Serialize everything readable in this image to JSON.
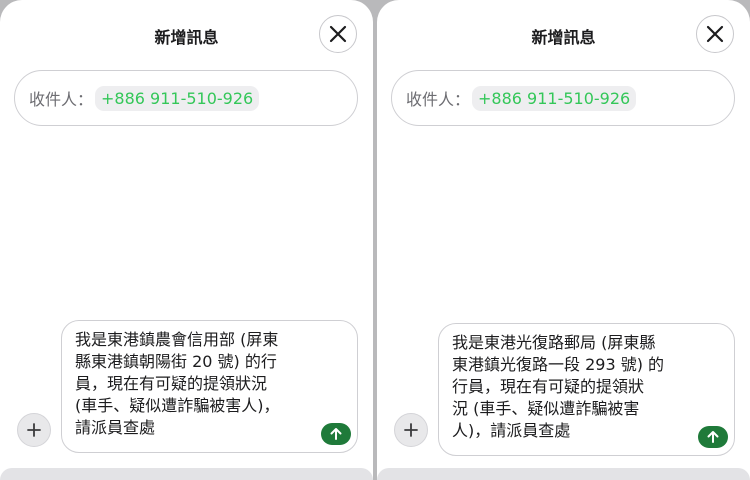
{
  "screens": [
    {
      "title": "新增訊息",
      "recipient_label": "收件人：",
      "recipient_number": "+886 911-510-926",
      "message": "我是東港鎮農會信用部 (屏東\n縣東港鎮朝陽街 20 號) 的行\n員，現在有可疑的提領狀況\n(車手、疑似遭詐騙被害人)，\n請派員查處"
    },
    {
      "title": "新增訊息",
      "recipient_label": "收件人：",
      "recipient_number": "+886 911-510-926",
      "message": "我是東港光復路郵局 (屏東縣\n東港鎮光復路一段 293 號) 的\n行員，現在有可疑的提領狀\n況 (車手、疑似遭詐騙被害\n人)，請派員查處"
    }
  ],
  "icons": {
    "close": "close-icon",
    "plus": "plus-icon",
    "send": "arrow-up-icon"
  },
  "colors": {
    "accent_green": "#34c759",
    "send_green": "#1f7a3a"
  }
}
